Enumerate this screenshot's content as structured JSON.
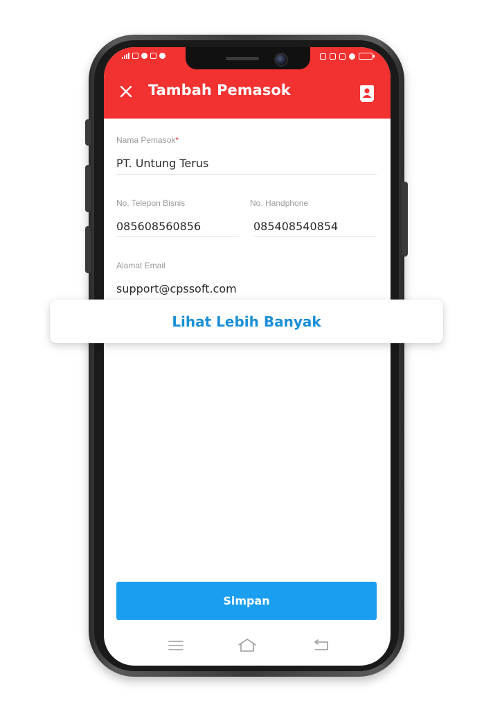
{
  "header": {
    "title": "Tambah Pemasok",
    "close_icon": "close-icon",
    "contact_icon": "contact-book-icon",
    "background_color": "#f23131"
  },
  "form": {
    "supplier_name": {
      "label": "Nama Pemasok",
      "required_mark": "*",
      "value": "PT. Untung Terus"
    },
    "business_phone": {
      "label": "No. Telepon Bisnis",
      "value": "085608560856"
    },
    "mobile_phone": {
      "label": "No. Handphone",
      "value": "085408540854"
    },
    "email": {
      "label": "Alamat Email",
      "value": "support@cpssoft.com"
    }
  },
  "banner": {
    "label": "Lihat Lebih Banyak",
    "color": "#1a8fd8"
  },
  "footer": {
    "save_label": "Simpan",
    "save_color": "#1a9ef0"
  },
  "nav": {
    "menu_icon": "menu-icon",
    "home_icon": "home-icon",
    "back_icon": "back-icon"
  }
}
